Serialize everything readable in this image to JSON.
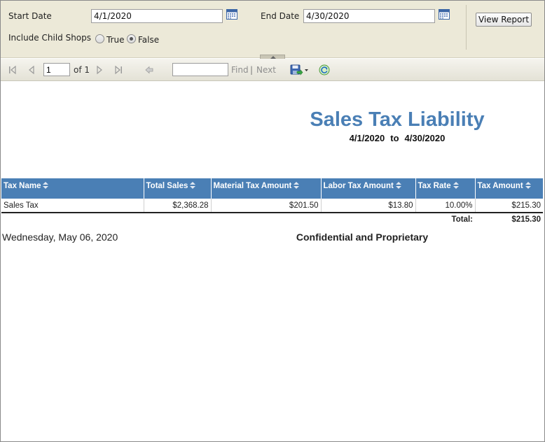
{
  "params": {
    "start_date_label": "Start Date",
    "start_date_value": "4/1/2020",
    "end_date_label": "End Date",
    "end_date_value": "4/30/2020",
    "child_shops_label": "Include Child Shops",
    "radio_true_label": "True",
    "radio_false_label": "False",
    "selected": "False",
    "view_report_label": "View Report"
  },
  "toolbar": {
    "page_value": "1",
    "of_label": "of 1",
    "find_label": "Find",
    "separator": "|",
    "next_label": "Next"
  },
  "report": {
    "title": "Sales Tax Liability",
    "from_date": "4/1/2020",
    "to_label": "to",
    "to_date": "4/30/2020",
    "columns": [
      "Tax Name",
      "Total Sales",
      "Material Tax Amount",
      "Labor Tax Amount",
      "Tax Rate",
      "Tax Amount"
    ],
    "rows": [
      [
        "Sales Tax",
        "$2,368.28",
        "$201.50",
        "$13.80",
        "10.00%",
        "$215.30"
      ]
    ],
    "total_label": "Total:",
    "total_value": "$215.30",
    "footer_date": "Wednesday, May 06, 2020",
    "footer_confidential": "Confidential and Proprietary"
  },
  "colors": {
    "header_blue": "#4a7fb5",
    "param_bg": "#ece9d8"
  }
}
